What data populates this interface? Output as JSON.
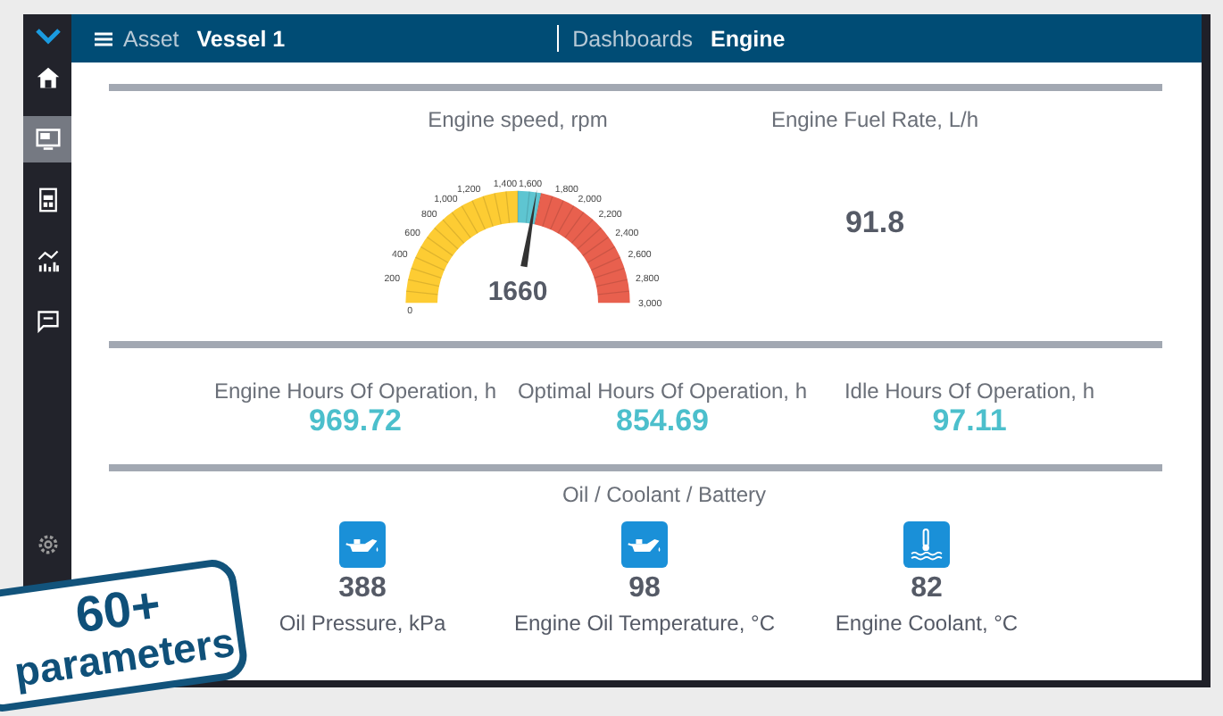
{
  "header": {
    "asset_label": "Asset",
    "asset": "Vessel 1",
    "dashboards_label": "Dashboards",
    "dashboard": "Engine"
  },
  "sidebar": {
    "items": [
      {
        "kind": "home",
        "selected": false
      },
      {
        "kind": "dashboard",
        "selected": true
      },
      {
        "kind": "report",
        "selected": false
      },
      {
        "kind": "chart",
        "selected": false
      },
      {
        "kind": "chat",
        "selected": false
      },
      {
        "kind": "settings",
        "selected": false
      }
    ]
  },
  "gauge": {
    "title": "Engine speed, rpm",
    "value": "1660",
    "level": 0.5533,
    "ticks": [
      "0",
      "200",
      "400",
      "600",
      "800",
      "1,000",
      "1,200",
      "1,400",
      "1,600",
      "1,800",
      "2,000",
      "2,200",
      "2,400",
      "2,600",
      "2,800",
      "3,000"
    ],
    "zones": [
      {
        "color": "#fdcc33",
        "level": 0.5
      },
      {
        "color": "#5ec5d1",
        "level": 0.5667
      },
      {
        "color": "#e8604e",
        "level": 1
      }
    ]
  },
  "fuel_rate": {
    "title": "Engine Fuel Rate, L/h",
    "value": "91.8"
  },
  "hours": [
    {
      "title": "Engine Hours Of Operation, h",
      "value": "969.72"
    },
    {
      "title": "Optimal Hours Of Operation, h",
      "value": "854.69"
    },
    {
      "title": "Idle Hours Of Operation, h",
      "value": "97.11"
    }
  ],
  "oil_section": {
    "title": "Oil / Coolant / Battery",
    "items": [
      {
        "kind": "oil",
        "value": "388",
        "label": "Oil Pressure, kPa"
      },
      {
        "kind": "oil",
        "value": "98",
        "label": "Engine Oil Temperature, °C"
      },
      {
        "kind": "coolant",
        "value": "82",
        "label": "Engine Coolant, °C"
      }
    ]
  },
  "badge": {
    "lines": [
      "60+",
      "parameters"
    ]
  }
}
